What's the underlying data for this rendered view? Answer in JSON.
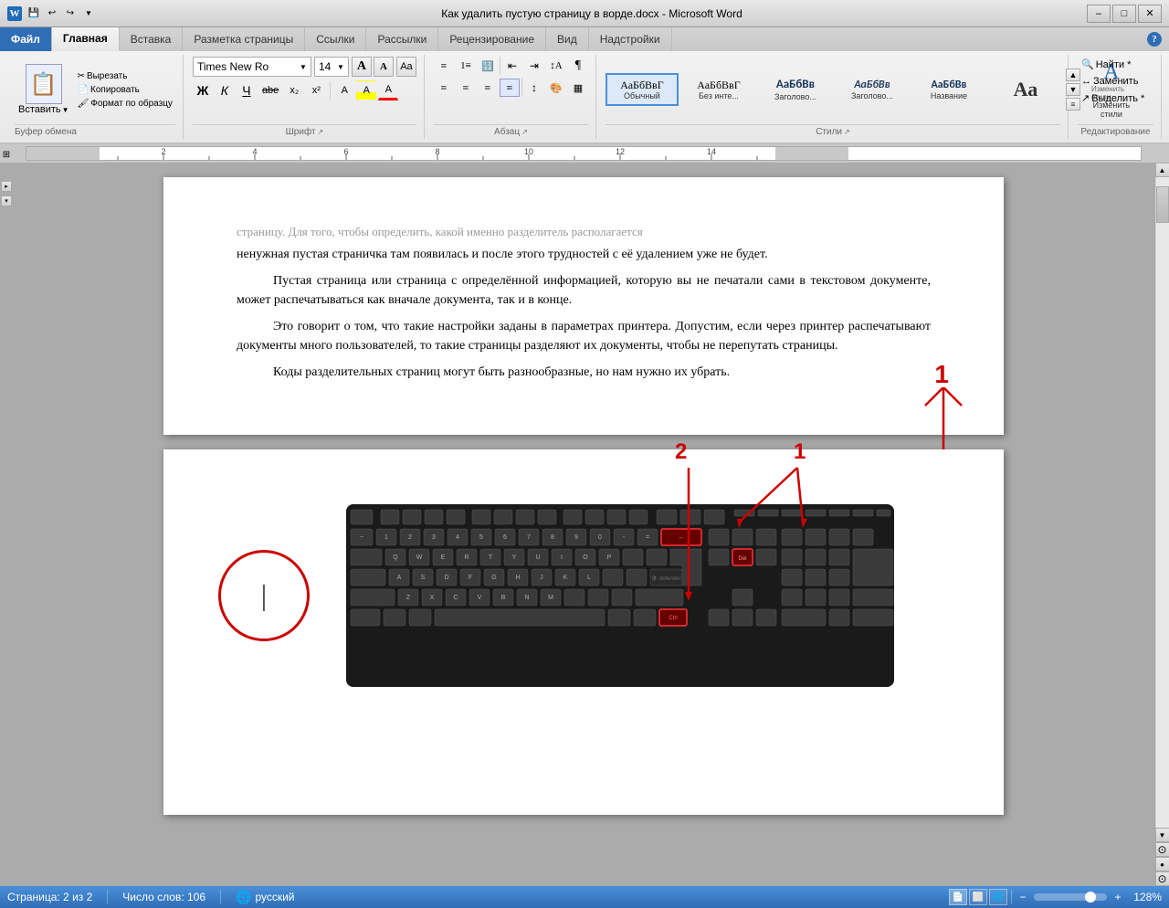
{
  "window": {
    "title": "Как удалить пустую страницу в ворде.docx - Microsoft Word",
    "min_label": "–",
    "max_label": "□",
    "close_label": "✕"
  },
  "quickaccess": {
    "icons": [
      "💾",
      "↩",
      "↪"
    ]
  },
  "ribbon": {
    "tabs": [
      "Файл",
      "Главная",
      "Вставка",
      "Разметка страницы",
      "Ссылки",
      "Рассылки",
      "Рецензирование",
      "Вид",
      "Надстройки"
    ],
    "active_tab": "Главная",
    "clipboard": {
      "label": "Буфер обмена",
      "paste_label": "Вставить",
      "cut_label": "Вырезать",
      "copy_label": "Копировать",
      "format_label": "Формат по образцу"
    },
    "font": {
      "label": "Шрифт",
      "name": "Times New Ro",
      "size": "14",
      "bold": "Ж",
      "italic": "К",
      "underline": "Ч",
      "strikethrough": "abe",
      "subscript": "x₂",
      "superscript": "x²",
      "grow": "A",
      "shrink": "A",
      "color": "A",
      "highlight": "A"
    },
    "paragraph": {
      "label": "Абзац",
      "align_left": "≡",
      "align_center": "≡",
      "align_right": "≡",
      "align_justify": "≡",
      "line_spacing": "↕",
      "indent": "→"
    },
    "styles": {
      "label": "Стили",
      "items": [
        {
          "name": "Обычный",
          "class": "normal",
          "active": true
        },
        {
          "name": "Без инте...",
          "class": "no-spacing",
          "active": false
        },
        {
          "name": "Заголово...",
          "class": "heading1",
          "active": false
        },
        {
          "name": "Заголово...",
          "class": "heading2",
          "active": false
        },
        {
          "name": "Название",
          "class": "title",
          "active": false
        },
        {
          "name": "Аа",
          "class": "default",
          "active": false
        }
      ]
    },
    "editing": {
      "label": "Редактирование",
      "find_label": "Найти *",
      "replace_label": "Заменить",
      "select_label": "Выделить *"
    }
  },
  "document": {
    "page1": {
      "blurry_line": "страницу. Для того, чтобы определить, какой именно разделитель располагается",
      "para1": "ненужная пустая страничка там появилась и после этого трудностей с её удалением уже не будет.",
      "para2": "Пустая страница или страница с определённой информацией, которую вы не печатали сами в текстовом документе, может распечатываться как вначале документа, так и в конце.",
      "para3": "Это говорит о том, что такие настройки заданы в параметрах принтера. Допустим, если через принтер распечатывают документы много пользователей, то такие страницы разделяют их документы, чтобы не перепутать страницы.",
      "para4": "Коды разделительных страниц могут быть разнообразные, но нам нужно их убрать."
    },
    "page2": {
      "annotation1": "1",
      "annotation2": "2"
    }
  },
  "status_bar": {
    "page_info": "Страница: 2 из 2",
    "word_count": "Число слов: 106",
    "lang": "русский",
    "zoom": "128%",
    "view_icons": [
      "📄",
      "🖼",
      "📋",
      "📝",
      "🔍"
    ]
  }
}
